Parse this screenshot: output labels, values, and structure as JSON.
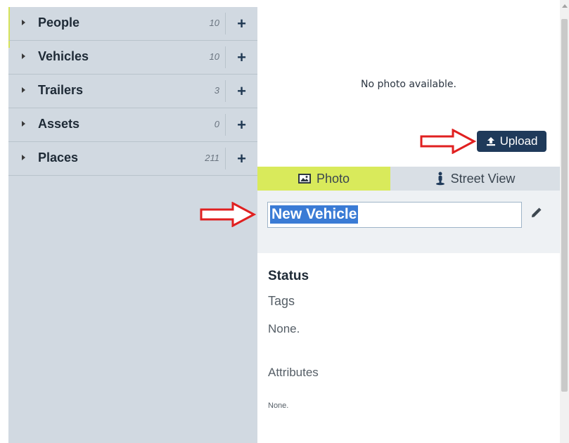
{
  "sidebar": {
    "items": [
      {
        "label": "People",
        "count": "10",
        "add": "+"
      },
      {
        "label": "Vehicles",
        "count": "10",
        "add": "+"
      },
      {
        "label": "Trailers",
        "count": "3",
        "add": "+"
      },
      {
        "label": "Assets",
        "count": "0",
        "add": "+"
      },
      {
        "label": "Places",
        "count": "211",
        "add": "+"
      }
    ]
  },
  "photo": {
    "no_photo_text": "No photo available.",
    "upload_label": "Upload",
    "upload_icon": "upload-icon"
  },
  "tabs": [
    {
      "label": "Photo",
      "icon": "image-icon",
      "active": true
    },
    {
      "label": "Street View",
      "icon": "street-view-icon",
      "active": false
    }
  ],
  "name": {
    "value": "New Vehicle",
    "edit_icon": "pencil-icon"
  },
  "details": {
    "status_heading": "Status",
    "tags_label": "Tags",
    "tags_value": "None.",
    "attributes_label": "Attributes",
    "attributes_value": "None."
  },
  "annotations": {
    "arrow_color": "#e02020"
  },
  "colors": {
    "active_tab": "#d9ea5b",
    "upload_button": "#1f3a5a",
    "selection": "#3a7bd5"
  }
}
